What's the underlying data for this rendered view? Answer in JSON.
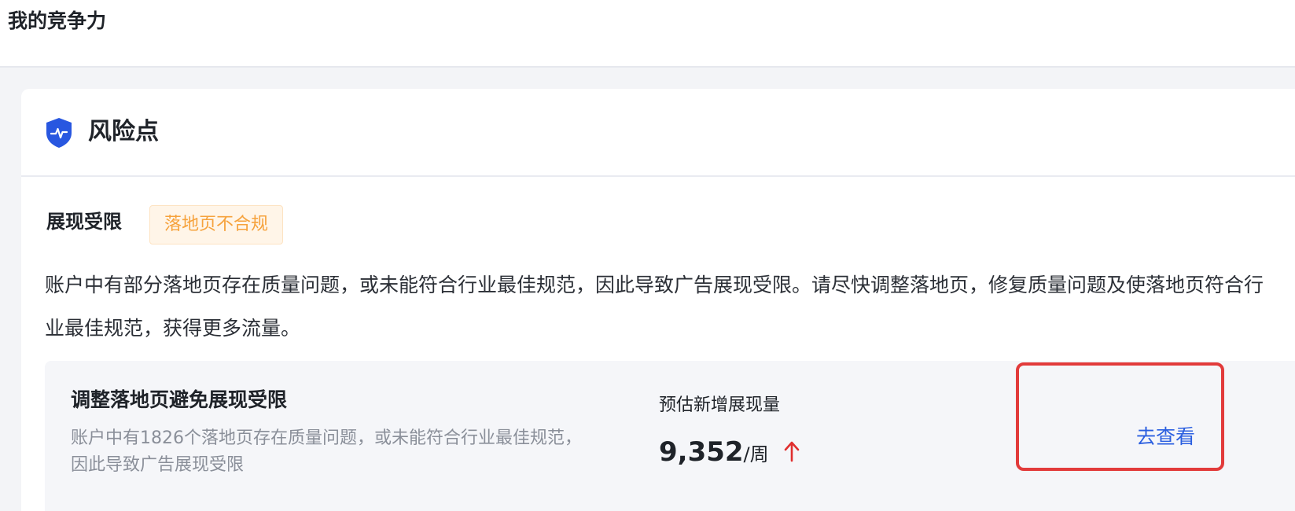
{
  "header": {
    "title": "我的竞争力"
  },
  "risk_card": {
    "title": "风险点",
    "icon": "shield-icon",
    "limit_label": "展现受限",
    "tag": "落地页不合规",
    "description": "账户中有部分落地页存在质量问题，或未能符合行业最佳规范，因此导致广告展现受限。请尽快调整落地页，修复质量问题及使落地页符合行业最佳规范，获得更多流量。",
    "suggestion": {
      "title": "调整落地页避免展现受限",
      "description": "账户中有1826个落地页存在质量问题，或未能符合行业最佳规范，因此导致广告展现受限",
      "metric_label": "预估新增展现量",
      "metric_value": "9,352",
      "metric_unit": "/周",
      "trend_icon": "arrow-up-icon",
      "action_label": "去查看"
    }
  },
  "colors": {
    "accent_blue": "#2b5fe0",
    "shield_blue": "#2857e0",
    "tag_orange": "#f6a23c",
    "trend_red": "#e02f2f",
    "highlight_red": "#e23b3b"
  }
}
